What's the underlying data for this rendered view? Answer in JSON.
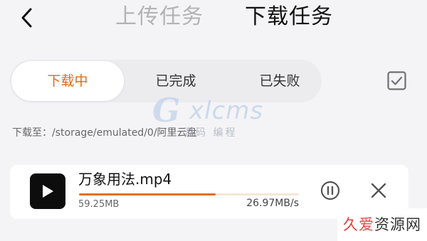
{
  "header": {
    "tabs": [
      {
        "label": "上传任务",
        "active": false
      },
      {
        "label": "下载任务",
        "active": true
      }
    ]
  },
  "filter": {
    "tabs": [
      {
        "label": "下载中",
        "active": true
      },
      {
        "label": "已完成",
        "active": false
      },
      {
        "label": "已失败",
        "active": false
      }
    ]
  },
  "save_path": "下载至：/storage/emulated/0/阿里云盘",
  "downloads": [
    {
      "file_name": "万象用法.mp4",
      "downloaded_size": "59.25MB",
      "speed": "26.97MB/s",
      "progress_percent": 62
    }
  ],
  "watermark": {
    "logo_letter": "G",
    "text": "xlcms",
    "subtitle": "源码 编程"
  },
  "site_badge": {
    "char1": "久",
    "char2": "爱",
    "rest": "资源网"
  },
  "colors": {
    "accent": "#e06a12",
    "progress": "#e0701a",
    "background": "#f4f4f6"
  },
  "icons": {
    "back": "chevron-left-icon",
    "select_all": "checkbox-checked-icon",
    "thumb": "play-icon",
    "pause": "pause-icon",
    "cancel": "close-icon"
  }
}
